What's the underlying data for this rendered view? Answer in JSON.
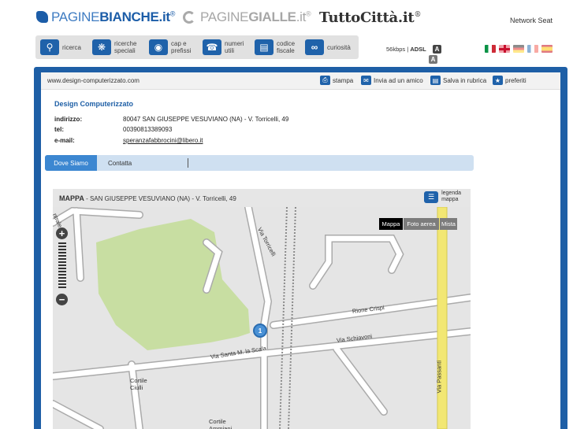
{
  "brands": {
    "paginebianche": {
      "a": "PAGINE",
      "b": "BIANCHE",
      "c": ".it",
      "reg": "®"
    },
    "paginegialle": {
      "a": "PAGINE",
      "b": "GIALLE",
      "c": ".it",
      "reg": "®"
    },
    "tuttocitta": {
      "a": "TuttoCittà",
      "c": ".it",
      "reg": "®"
    },
    "network": "Network Seat"
  },
  "nav": [
    {
      "label": "ricerca",
      "icon": "search-icon"
    },
    {
      "label": "ricerche\nspeciali",
      "icon": "puzzle-icon"
    },
    {
      "label": "cap e\nprefissi",
      "icon": "globe-icon"
    },
    {
      "label": "numeri\nutili",
      "icon": "phone-icon"
    },
    {
      "label": "codice\nfiscale",
      "icon": "card-icon"
    },
    {
      "label": "curiosità",
      "icon": "spiral-icon"
    }
  ],
  "connection": {
    "speed": "56kbps",
    "type": "ADSL"
  },
  "font_size_buttons": [
    "A",
    "A"
  ],
  "url": "www.design-computerizzato.com",
  "tools": [
    "stampa",
    "Invia ad un amico",
    "Salva in rubrica",
    "preferiti"
  ],
  "business": {
    "name": "Design Computerizzato",
    "address_label": "indirizzo:",
    "address": "80047 SAN GIUSEPPE VESUVIANO (NA) - V. Torricelli, 49",
    "tel_label": "tel:",
    "tel": "00390813389093",
    "email_label": "e-mail:",
    "email": "speranzafabbrocini@libero.it"
  },
  "tabs": {
    "active": "Dove Siamo",
    "other": "Contatta"
  },
  "map": {
    "title": "MAPPA",
    "subtitle": " - SAN GIUSEPPE VESUVIANO (NA) - V. Torricelli, 49",
    "legend": "legenda\nmappa",
    "types": [
      "Mappa",
      "Foto aerea",
      "Mista"
    ],
    "zoom_in": "+",
    "zoom_out": "−",
    "marker": "1",
    "streets": {
      "torricelli": "Via Torricelli",
      "crispi": "Rione Crispi",
      "schiavoni": "Via Schiavoni",
      "santa_maria": "Via Santa M. la Scala",
      "passanti": "Via Passanti",
      "cortile_ciulli": "Cortile\nCiulli",
      "cortile_2": "Cortile\nAmmiani",
      "corner": "ntrale"
    }
  },
  "colors": {
    "brand_blue": "#1e5fa6",
    "tab_active": "#3c87d1",
    "park": "#c8dea2",
    "road_yellow": "#f2e773"
  }
}
